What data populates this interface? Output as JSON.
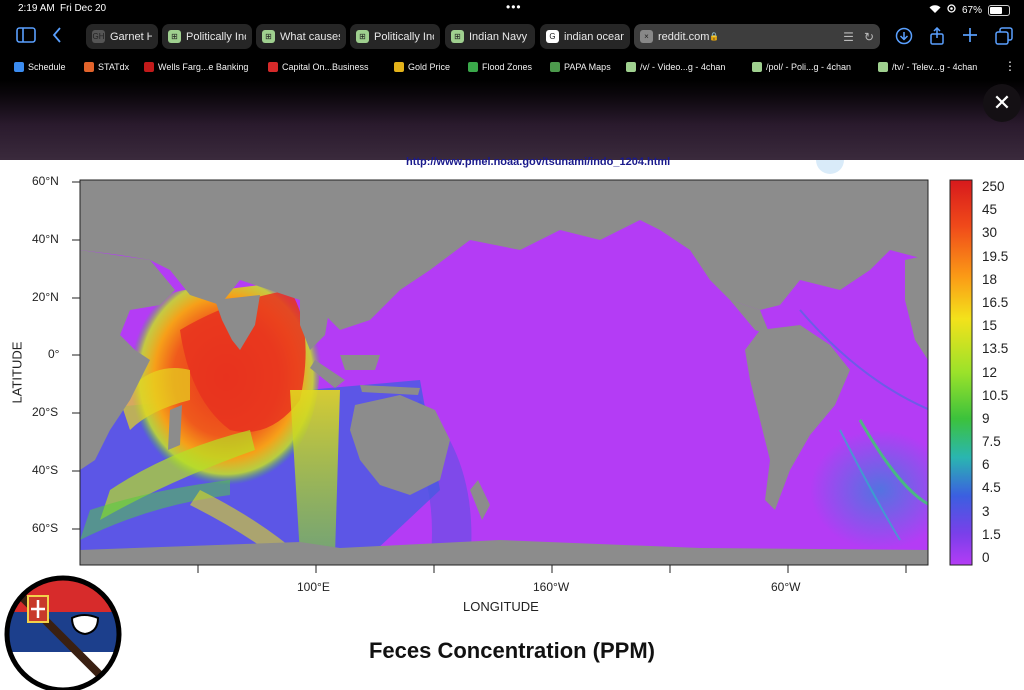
{
  "status_bar": {
    "time": "2:19 AM",
    "date": "Fri Dec 20",
    "battery": "67%",
    "dots": "•••"
  },
  "tabs": [
    {
      "label": "Garnet Hi",
      "fav": "GH",
      "fav_color": "#555555"
    },
    {
      "label": "Politically Inc",
      "fav": "⊞",
      "fav_color": "#9fd08f"
    },
    {
      "label": "What causes",
      "fav": "⊞",
      "fav_color": "#9fd08f"
    },
    {
      "label": "Politically Inc",
      "fav": "⊞",
      "fav_color": "#9fd08f"
    },
    {
      "label": "Indian Navy",
      "fav": "⊞",
      "fav_color": "#9fd08f"
    },
    {
      "label": "indian ocean",
      "fav": "G",
      "fav_color": "#ffffff"
    },
    {
      "label": "reddit.com",
      "fav": "×",
      "fav_color": "#888888"
    }
  ],
  "bookmarks": [
    {
      "label": "Schedule",
      "color": "#3b8cf0"
    },
    {
      "label": "STATdx",
      "color": "#e2632b"
    },
    {
      "label": "Wells Farg...e Banking",
      "color": "#c21a1a"
    },
    {
      "label": "Capital On...Business",
      "color": "#d62a2a"
    },
    {
      "label": "Gold Price",
      "color": "#e3b21a"
    },
    {
      "label": "Flood Zones",
      "color": "#3aa84a"
    },
    {
      "label": "PAPA Maps",
      "color": "#4c9a4c"
    },
    {
      "label": "/v/ - Video...g - 4chan",
      "color": "#9fd08f"
    },
    {
      "label": "/pol/ - Poli...g - 4chan",
      "color": "#9fd08f"
    },
    {
      "label": "/tv/ - Telev...g - 4chan",
      "color": "#9fd08f"
    }
  ],
  "map": {
    "source_url": "http://www.pmel.noaa.gov/tsunami/indo_1204.html",
    "title": "Feces Concentration (PPM)",
    "xlabel": "LONGITUDE",
    "ylabel": "LATITUDE",
    "lat_ticks": [
      "60°N",
      "40°N",
      "20°N",
      "0°",
      "20°S",
      "40°S",
      "60°S"
    ],
    "lon_ticks": [
      "100°E",
      "160°W",
      "60°W"
    ],
    "colorbar_labels": [
      "250",
      "45",
      "30",
      "19.5",
      "18",
      "16.5",
      "15",
      "13.5",
      "12",
      "10.5",
      "9",
      "7.5",
      "6",
      "4.5",
      "3",
      "1.5",
      "0"
    ],
    "colors": {
      "ocean": "#b43cf5",
      "land": "#8c8c8c",
      "hot": "#e8321e"
    }
  }
}
